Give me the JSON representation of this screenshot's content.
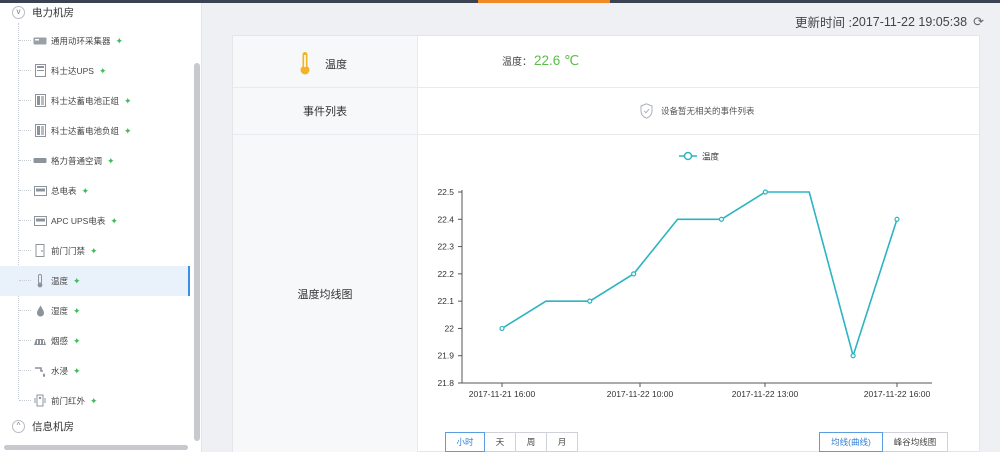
{
  "sidebar": {
    "group1": {
      "label": "电力机房",
      "toggle": "v"
    },
    "items": [
      {
        "label": "通用动环采集器",
        "icon": "collector-icon"
      },
      {
        "label": "科士达UPS",
        "icon": "ups-icon"
      },
      {
        "label": "科士达蓄电池正组",
        "icon": "battery-icon"
      },
      {
        "label": "科士达蓄电池负组",
        "icon": "battery-icon"
      },
      {
        "label": "格力普通空调",
        "icon": "aircon-icon"
      },
      {
        "label": "总电表",
        "icon": "meter-icon"
      },
      {
        "label": "APC UPS电表",
        "icon": "meter-icon"
      },
      {
        "label": "前门门禁",
        "icon": "door-icon"
      },
      {
        "label": "温度",
        "icon": "thermometer-icon"
      },
      {
        "label": "湿度",
        "icon": "drop-icon"
      },
      {
        "label": "烟感",
        "icon": "smoke-icon"
      },
      {
        "label": "水浸",
        "icon": "water-icon"
      },
      {
        "label": "前门红外",
        "icon": "infrared-icon"
      }
    ],
    "active_index": 8,
    "group2": {
      "label": "信息机房",
      "toggle": "^"
    }
  },
  "header": {
    "update_label": "更新时间 :",
    "update_time": "2017-11-22 19:05:38"
  },
  "panel": {
    "temp_title": "温度",
    "temp_value_label": "温度：",
    "temp_value": "22.6 ℃",
    "events_title": "事件列表",
    "events_empty": "设备暂无相关的事件列表",
    "curve_title": "温度均线图"
  },
  "chart_data": {
    "type": "line",
    "series": [
      {
        "name": "温度",
        "values": [
          22.0,
          22.1,
          22.1,
          22.2,
          22.4,
          22.4,
          22.5,
          22.5,
          21.9,
          22.4
        ]
      }
    ],
    "x_ticks": [
      "2017-11-21 16:00",
      "2017-11-22 10:00",
      "2017-11-22 13:00",
      "2017-11-22 16:00"
    ],
    "y_ticks": [
      "21.8",
      "21.9",
      "22",
      "22.1",
      "22.2",
      "22.3",
      "22.4",
      "22.5"
    ],
    "ylim": [
      21.8,
      22.5
    ],
    "legend_position": "top-center",
    "color": "#2bb4c1"
  },
  "controls": {
    "range_buttons": [
      "小时",
      "天",
      "周",
      "月"
    ],
    "range_active": 0,
    "mode_buttons": [
      "均线(曲线)",
      "峰谷均线图"
    ],
    "mode_active": 0
  }
}
